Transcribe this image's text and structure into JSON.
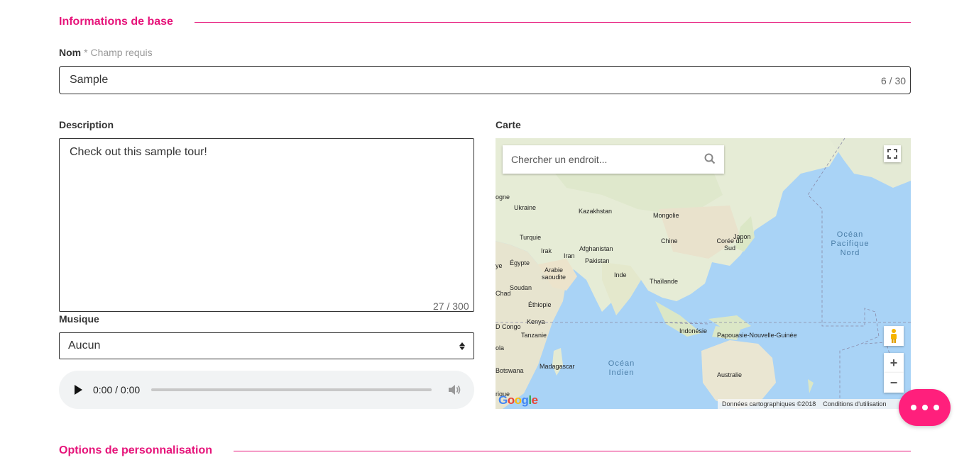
{
  "section_basic": {
    "title": "Informations de base"
  },
  "name_field": {
    "label": "Nom",
    "required_note": "* Champ requis",
    "value": "Sample",
    "counter": "6 / 30"
  },
  "description_field": {
    "label": "Description",
    "value": "Check out this sample tour!",
    "counter": "27 / 300"
  },
  "music_field": {
    "label": "Musique",
    "selected": "Aucun"
  },
  "audio_player": {
    "time": "0:00 / 0:00",
    "progress": 0
  },
  "map": {
    "label": "Carte",
    "search_placeholder": "Chercher un endroit...",
    "places": {
      "ukraine": "Ukraine",
      "kazakhstan": "Kazakhstan",
      "mongolie": "Mongolie",
      "turquie": "Turquie",
      "afghanistan": "Afghanistan",
      "chine": "Chine",
      "coree": "Corée du Sud",
      "japon": "Japon",
      "irak": "Irak",
      "iran": "Iran",
      "pakistan": "Pakistan",
      "egypte": "Égypte",
      "arabie": "Arabie saoudite",
      "inde": "Inde",
      "thailande": "Thaïlande",
      "soudan": "Soudan",
      "ethiopie": "Éthiopie",
      "kenya": "Kenya",
      "tanzanie": "Tanzanie",
      "indonesie": "Indonésie",
      "papouasie": "Papouasie-Nouvelle-Guinée",
      "madagascar": "Madagascar",
      "botswana": "Botswana",
      "australie": "Australie",
      "rdcongo": "D Congo",
      "chad": "Chad",
      "ogne": "ogne",
      "ola": "ola",
      "ye": "ye",
      "rique": "rique"
    },
    "ocean_pacifique": "Océan Pacifique Nord",
    "ocean_indien": "Océan Indien",
    "attribution": "Données cartographiques ©2018",
    "terms": "Conditions d'utilisation",
    "google": "Google"
  },
  "section_custom": {
    "title": "Options de personnalisation"
  },
  "colors": {
    "accent": "#e6147a",
    "fab": "#ff1f7c"
  }
}
